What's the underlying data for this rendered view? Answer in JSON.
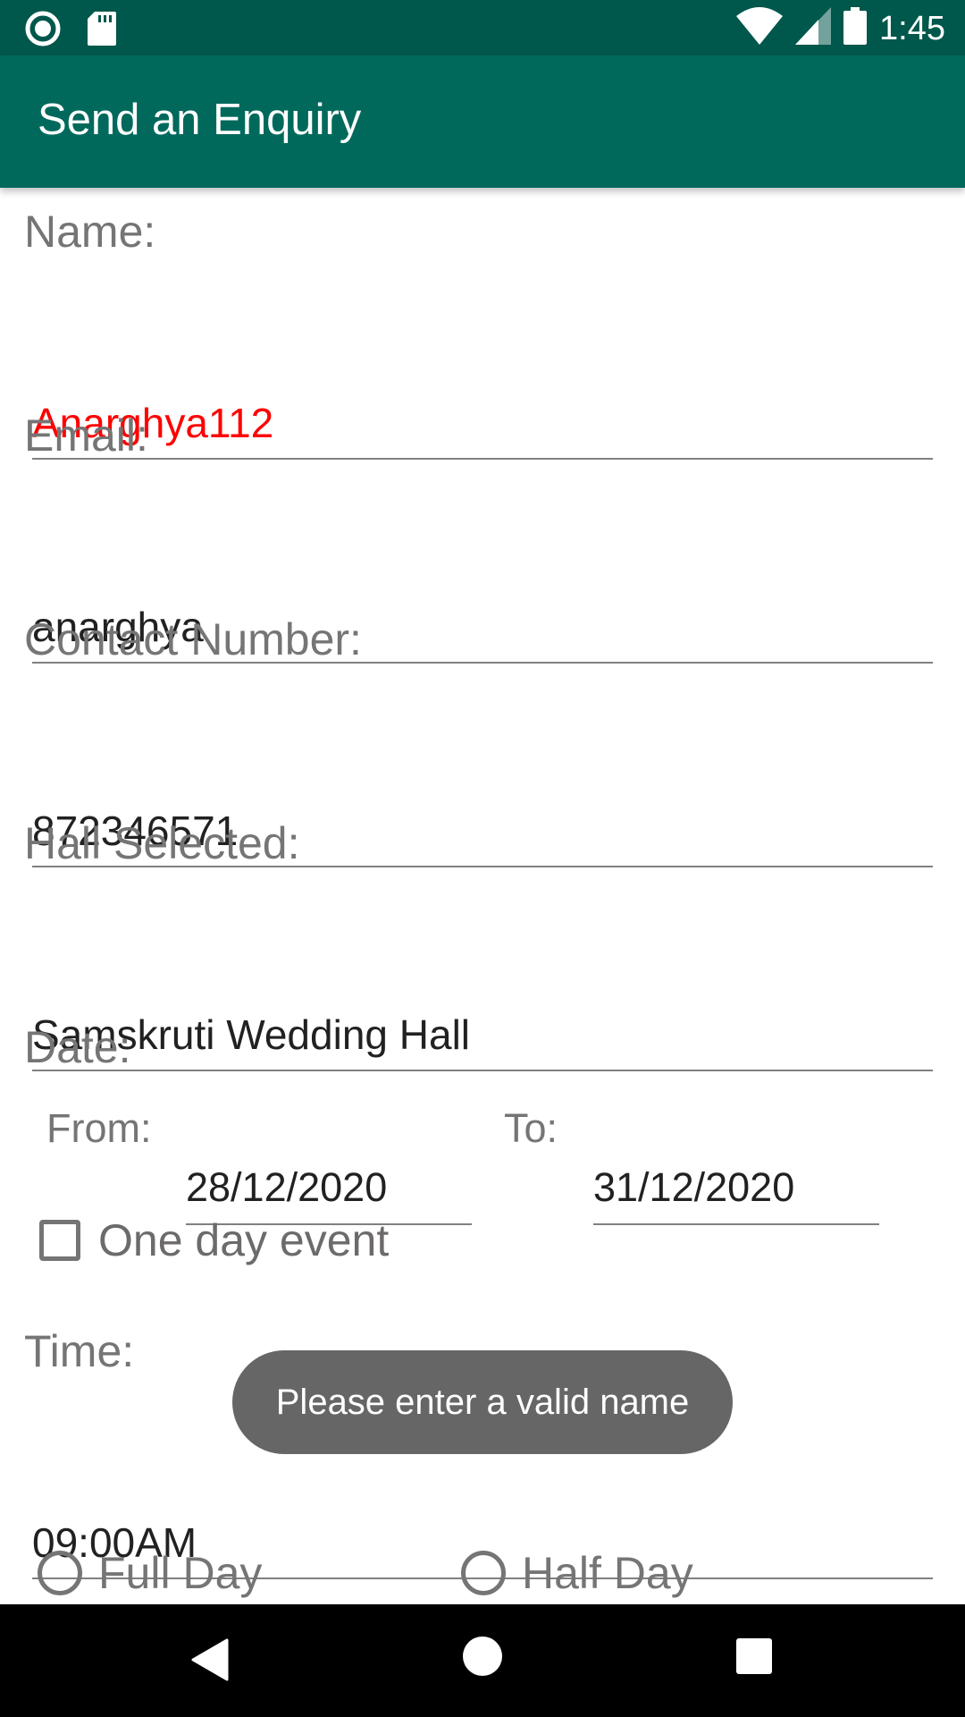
{
  "status_bar": {
    "time": "1:45",
    "icons": [
      "radio-icon",
      "sd-card-icon",
      "wifi-icon",
      "signal-icon",
      "battery-icon"
    ]
  },
  "app_bar": {
    "title": "Send an Enquiry"
  },
  "form": {
    "name": {
      "label": "Name:",
      "value": "Anarghya112"
    },
    "email": {
      "label": "Email:",
      "value": "anarghya"
    },
    "contact": {
      "label": "Contact Number:",
      "value": "872346571"
    },
    "hall": {
      "label": "Hall Selected:",
      "value": "Samskruti Wedding Hall"
    },
    "date": {
      "label": "Date:",
      "from_label": "From:",
      "from_value": "28/12/2020",
      "to_label": "To:",
      "to_value": "31/12/2020"
    },
    "one_day": {
      "label": "One day event",
      "checked": false
    },
    "time": {
      "label": "Time:",
      "value": "09:00AM"
    },
    "duration": {
      "full_day": "Full Day",
      "half_day": "Half Day"
    }
  },
  "toast": {
    "message": "Please enter a valid name"
  },
  "colors": {
    "status_bar": "#00574b",
    "app_bar": "#00695c",
    "error_text": "#ff0000",
    "toast_bg": "#666666"
  }
}
